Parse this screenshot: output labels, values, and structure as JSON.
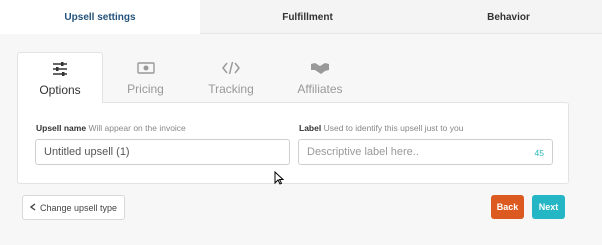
{
  "top_tabs": {
    "upsell_settings": "Upsell settings",
    "fulfillment": "Fulfillment",
    "behavior": "Behavior"
  },
  "sub_tabs": [
    {
      "label": "Options",
      "icon": "sliders-icon",
      "active": true
    },
    {
      "label": "Pricing",
      "icon": "money-icon",
      "active": false
    },
    {
      "label": "Tracking",
      "icon": "code-icon",
      "active": false
    },
    {
      "label": "Affiliates",
      "icon": "handshake-icon",
      "active": false
    }
  ],
  "form": {
    "name_label": "Upsell name",
    "name_hint": "Will appear on the invoice",
    "name_value": "Untitled upsell (1)",
    "label_label": "Label",
    "label_hint": "Used to identify this upsell just to you",
    "label_placeholder": "Descriptive label here..",
    "label_counter": "45"
  },
  "actions": {
    "change_type": "Change upsell type",
    "back": "Back",
    "next": "Next"
  },
  "colors": {
    "active_tab_text": "#23527c",
    "back_button": "#dc5a1f",
    "next_button": "#24b6c4",
    "counter": "#2ab7b5"
  }
}
